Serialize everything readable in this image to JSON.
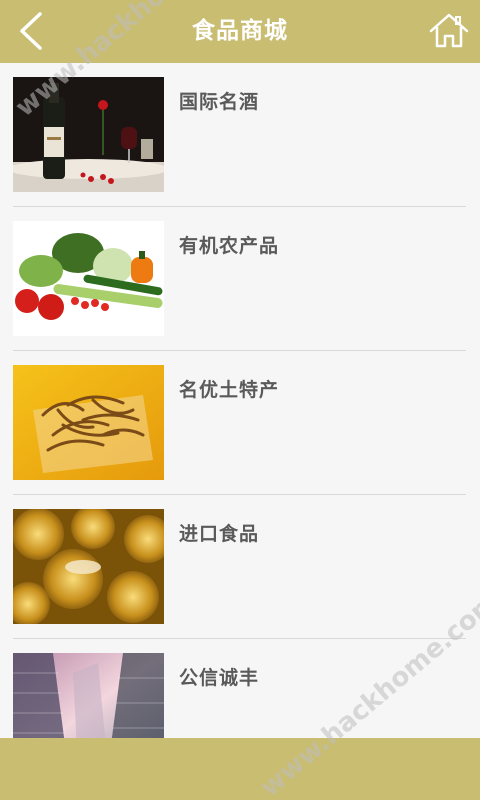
{
  "header": {
    "title": "食品商城",
    "back_icon": "back-arrow-icon",
    "home_icon": "home-icon",
    "bar_color": "#c9bd72"
  },
  "items": [
    {
      "label": "国际名酒",
      "thumb": "wine-image"
    },
    {
      "label": "有机农产品",
      "thumb": "vegetables-image"
    },
    {
      "label": "名优土特产",
      "thumb": "cordyceps-image"
    },
    {
      "label": "进口食品",
      "thumb": "chocolates-image"
    },
    {
      "label": "公信诚丰",
      "thumb": "buildings-image"
    }
  ],
  "watermark": "www.hackhome.com"
}
